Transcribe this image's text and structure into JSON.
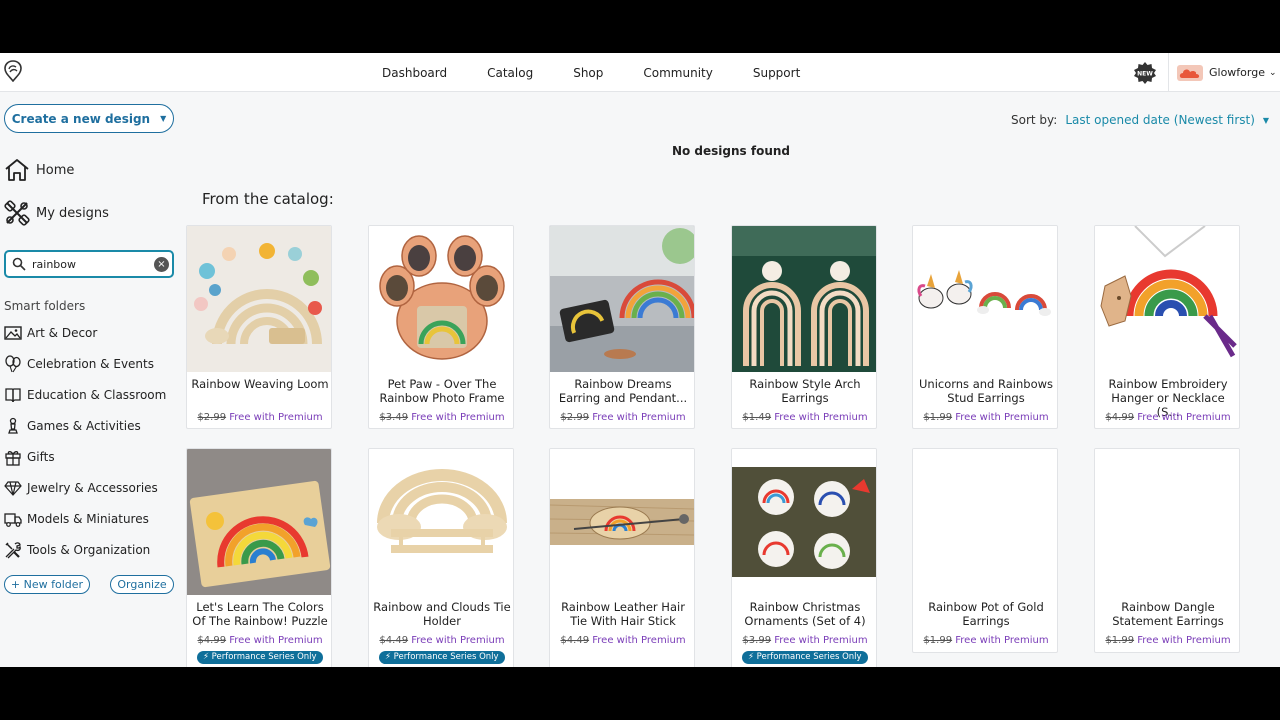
{
  "nav": {
    "links": [
      "Dashboard",
      "Catalog",
      "Shop",
      "Community",
      "Support"
    ],
    "new_badge": "NEW",
    "account_name": "Glowforge"
  },
  "sidebar": {
    "create_label": "Create a new design",
    "home_label": "Home",
    "designs_label": "My designs",
    "search_value": "rainbow",
    "smart_folders_title": "Smart folders",
    "folders": [
      {
        "label": "Art & Decor",
        "icon": "picture-icon"
      },
      {
        "label": "Celebration & Events",
        "icon": "balloons-icon"
      },
      {
        "label": "Education & Classroom",
        "icon": "book-icon"
      },
      {
        "label": "Games & Activities",
        "icon": "chess-pawn-icon"
      },
      {
        "label": "Gifts",
        "icon": "gift-icon"
      },
      {
        "label": "Jewelry & Accessories",
        "icon": "diamond-icon"
      },
      {
        "label": "Models & Miniatures",
        "icon": "truck-icon"
      },
      {
        "label": "Tools & Organization",
        "icon": "tools-icon"
      }
    ],
    "new_folder_label": "+ New folder",
    "organize_label": "Organize"
  },
  "main": {
    "sort_label": "Sort by:",
    "sort_value": "Last opened date (Newest first)",
    "empty_message": "No designs found",
    "catalog_heading": "From the catalog:",
    "premium_text": "Free with Premium",
    "performance_badge": "Performance Series Only",
    "cards": [
      {
        "title": "Rainbow Weaving Loom",
        "old_price": "$2.99",
        "performance": false
      },
      {
        "title": "Pet Paw - Over The Rainbow Photo Frame",
        "old_price": "$3.49",
        "performance": false
      },
      {
        "title": "Rainbow Dreams Earring and Pendant...",
        "old_price": "$2.99",
        "performance": false
      },
      {
        "title": "Rainbow Style Arch Earrings",
        "old_price": "$1.49",
        "performance": false
      },
      {
        "title": "Unicorns and Rainbows Stud Earrings",
        "old_price": "$1.99",
        "performance": false
      },
      {
        "title": "Rainbow Embroidery Hanger or Necklace (S...",
        "old_price": "$4.99",
        "performance": false
      },
      {
        "title": "Let's Learn The Colors Of The Rainbow! Puzzle",
        "old_price": "$4.99",
        "performance": true
      },
      {
        "title": "Rainbow and Clouds Tie Holder",
        "old_price": "$4.49",
        "performance": true
      },
      {
        "title": "Rainbow Leather Hair Tie With Hair Stick",
        "old_price": "$4.49",
        "performance": false
      },
      {
        "title": "Rainbow Christmas Ornaments (Set of 4)",
        "old_price": "$3.99",
        "performance": true
      },
      {
        "title": "Rainbow Pot of Gold Earrings",
        "old_price": "$1.99",
        "performance": false
      },
      {
        "title": "Rainbow Dangle Statement Earrings",
        "old_price": "$1.99",
        "performance": false
      }
    ]
  },
  "colors": {
    "accent": "#1f6f9f",
    "search_border": "#1a8aa8",
    "premium": "#7a3db8",
    "badge": "#0f6f9a"
  }
}
